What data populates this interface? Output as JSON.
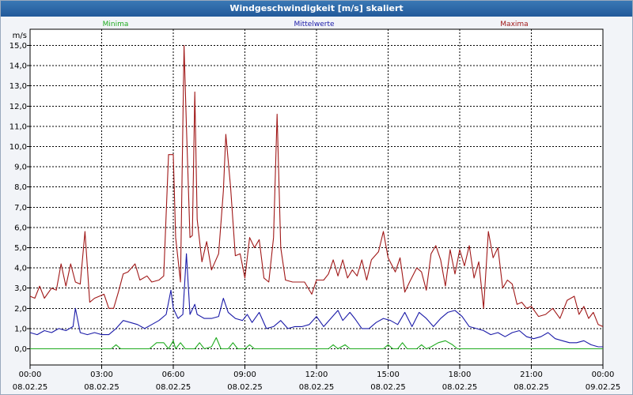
{
  "window": {
    "title": "Windgeschwindigkeit [m/s] skaliert"
  },
  "chart_data": {
    "type": "line",
    "title": "Windgeschwindigkeit [m/s] skaliert",
    "ylabel": "m/s",
    "ylim": [
      -0.8,
      15.8
    ],
    "xlim": [
      0,
      24
    ],
    "grid": true,
    "legend_position": "top",
    "yticks": [
      0,
      1,
      2,
      3,
      4,
      5,
      6,
      7,
      8,
      9,
      10,
      11,
      12,
      13,
      14,
      15
    ],
    "ytick_labels": [
      "0,0",
      "1,0",
      "2,0",
      "3,0",
      "4,0",
      "5,0",
      "6,0",
      "7,0",
      "8,0",
      "9,0",
      "10,0",
      "11,0",
      "12,0",
      "13,0",
      "14,0",
      "15,0"
    ],
    "xticks": [
      {
        "x": 0,
        "time": "00:00",
        "date": "08.02.25"
      },
      {
        "x": 3,
        "time": "03:00",
        "date": "08.02.25"
      },
      {
        "x": 6,
        "time": "06:00",
        "date": "08.02.25"
      },
      {
        "x": 9,
        "time": "09:00",
        "date": "08.02.25"
      },
      {
        "x": 12,
        "time": "12:00",
        "date": "08.02.25"
      },
      {
        "x": 15,
        "time": "15:00",
        "date": "08.02.25"
      },
      {
        "x": 18,
        "time": "18:00",
        "date": "08.02.25"
      },
      {
        "x": 21,
        "time": "21:00",
        "date": "08.02.25"
      },
      {
        "x": 24,
        "time": "00:00",
        "date": "09.02.25"
      }
    ],
    "series": [
      {
        "name": "Minima",
        "color": "#1faa1f",
        "points": [
          [
            0,
            0
          ],
          [
            3.4,
            0
          ],
          [
            3.6,
            0.2
          ],
          [
            3.8,
            0
          ],
          [
            5,
            0
          ],
          [
            5.3,
            0.3
          ],
          [
            5.6,
            0.3
          ],
          [
            5.8,
            0
          ],
          [
            6,
            0.4
          ],
          [
            6.1,
            0
          ],
          [
            6.3,
            0.3
          ],
          [
            6.5,
            0
          ],
          [
            6.9,
            0
          ],
          [
            7.1,
            0.3
          ],
          [
            7.3,
            0
          ],
          [
            7.6,
            0.1
          ],
          [
            7.8,
            0.55
          ],
          [
            8,
            0
          ],
          [
            8.3,
            0
          ],
          [
            8.5,
            0.3
          ],
          [
            8.7,
            0
          ],
          [
            9,
            0
          ],
          [
            9.2,
            0.2
          ],
          [
            9.4,
            0
          ],
          [
            12.5,
            0
          ],
          [
            12.7,
            0.2
          ],
          [
            12.9,
            0
          ],
          [
            13.2,
            0.2
          ],
          [
            13.4,
            0
          ],
          [
            14.8,
            0
          ],
          [
            15,
            0.2
          ],
          [
            15.2,
            0
          ],
          [
            15.4,
            0
          ],
          [
            15.6,
            0.3
          ],
          [
            15.8,
            0
          ],
          [
            16.2,
            0
          ],
          [
            16.4,
            0.2
          ],
          [
            16.6,
            0
          ],
          [
            16.8,
            0.1
          ],
          [
            17.1,
            0.3
          ],
          [
            17.4,
            0.4
          ],
          [
            17.7,
            0.2
          ],
          [
            17.9,
            0
          ],
          [
            24,
            0
          ]
        ]
      },
      {
        "name": "Mittelwerte",
        "color": "#1a1aa8",
        "points": [
          [
            0,
            0.8
          ],
          [
            0.3,
            0.7
          ],
          [
            0.6,
            0.9
          ],
          [
            0.9,
            0.8
          ],
          [
            1.2,
            1.0
          ],
          [
            1.5,
            0.9
          ],
          [
            1.8,
            1.1
          ],
          [
            1.9,
            2.0
          ],
          [
            2.1,
            0.8
          ],
          [
            2.4,
            0.7
          ],
          [
            2.7,
            0.8
          ],
          [
            3.0,
            0.7
          ],
          [
            3.3,
            0.7
          ],
          [
            3.6,
            1.0
          ],
          [
            3.9,
            1.4
          ],
          [
            4.2,
            1.3
          ],
          [
            4.5,
            1.2
          ],
          [
            4.8,
            1.0
          ],
          [
            5.1,
            1.2
          ],
          [
            5.4,
            1.4
          ],
          [
            5.7,
            1.7
          ],
          [
            5.9,
            2.9
          ],
          [
            6.0,
            2.0
          ],
          [
            6.2,
            1.5
          ],
          [
            6.4,
            1.7
          ],
          [
            6.55,
            4.7
          ],
          [
            6.7,
            1.7
          ],
          [
            6.9,
            2.2
          ],
          [
            7.0,
            1.7
          ],
          [
            7.3,
            1.5
          ],
          [
            7.6,
            1.5
          ],
          [
            7.9,
            1.6
          ],
          [
            8.1,
            2.5
          ],
          [
            8.3,
            1.8
          ],
          [
            8.6,
            1.5
          ],
          [
            8.9,
            1.4
          ],
          [
            9.1,
            1.7
          ],
          [
            9.3,
            1.3
          ],
          [
            9.6,
            1.8
          ],
          [
            9.9,
            1.0
          ],
          [
            10.2,
            1.1
          ],
          [
            10.5,
            1.4
          ],
          [
            10.8,
            1.0
          ],
          [
            11.1,
            1.1
          ],
          [
            11.4,
            1.1
          ],
          [
            11.7,
            1.2
          ],
          [
            12.0,
            1.6
          ],
          [
            12.3,
            1.1
          ],
          [
            12.6,
            1.5
          ],
          [
            12.9,
            1.9
          ],
          [
            13.1,
            1.4
          ],
          [
            13.4,
            1.8
          ],
          [
            13.6,
            1.5
          ],
          [
            13.9,
            1.0
          ],
          [
            14.2,
            1.0
          ],
          [
            14.5,
            1.3
          ],
          [
            14.8,
            1.5
          ],
          [
            15.1,
            1.4
          ],
          [
            15.4,
            1.2
          ],
          [
            15.7,
            1.8
          ],
          [
            16.0,
            1.1
          ],
          [
            16.3,
            1.8
          ],
          [
            16.6,
            1.5
          ],
          [
            16.9,
            1.1
          ],
          [
            17.2,
            1.5
          ],
          [
            17.5,
            1.8
          ],
          [
            17.8,
            1.9
          ],
          [
            18.1,
            1.6
          ],
          [
            18.4,
            1.1
          ],
          [
            18.7,
            1.0
          ],
          [
            19.0,
            0.9
          ],
          [
            19.3,
            0.7
          ],
          [
            19.6,
            0.8
          ],
          [
            19.9,
            0.6
          ],
          [
            20.2,
            0.8
          ],
          [
            20.5,
            0.9
          ],
          [
            20.8,
            0.6
          ],
          [
            21.1,
            0.5
          ],
          [
            21.4,
            0.6
          ],
          [
            21.7,
            0.8
          ],
          [
            22.0,
            0.5
          ],
          [
            22.3,
            0.4
          ],
          [
            22.6,
            0.3
          ],
          [
            22.9,
            0.3
          ],
          [
            23.2,
            0.4
          ],
          [
            23.5,
            0.2
          ],
          [
            23.8,
            0.1
          ],
          [
            24,
            0.1
          ]
        ]
      },
      {
        "name": "Maxima",
        "color": "#a01818",
        "points": [
          [
            0,
            2.6
          ],
          [
            0.2,
            2.5
          ],
          [
            0.4,
            3.1
          ],
          [
            0.6,
            2.5
          ],
          [
            0.9,
            3.0
          ],
          [
            1.1,
            2.9
          ],
          [
            1.3,
            4.2
          ],
          [
            1.5,
            3.1
          ],
          [
            1.7,
            4.2
          ],
          [
            1.9,
            3.3
          ],
          [
            2.1,
            3.2
          ],
          [
            2.3,
            5.8
          ],
          [
            2.5,
            2.3
          ],
          [
            2.7,
            2.5
          ],
          [
            2.9,
            2.6
          ],
          [
            3.1,
            2.7
          ],
          [
            3.3,
            2.0
          ],
          [
            3.5,
            2.0
          ],
          [
            3.7,
            2.8
          ],
          [
            3.9,
            3.7
          ],
          [
            4.1,
            3.8
          ],
          [
            4.4,
            4.2
          ],
          [
            4.6,
            3.4
          ],
          [
            4.9,
            3.6
          ],
          [
            5.1,
            3.3
          ],
          [
            5.4,
            3.4
          ],
          [
            5.6,
            3.6
          ],
          [
            5.8,
            9.6
          ],
          [
            6.0,
            9.6
          ],
          [
            6.1,
            5.5
          ],
          [
            6.3,
            3.3
          ],
          [
            6.45,
            15.0
          ],
          [
            6.55,
            11.0
          ],
          [
            6.7,
            5.5
          ],
          [
            6.8,
            5.6
          ],
          [
            6.9,
            12.7
          ],
          [
            7.0,
            6.4
          ],
          [
            7.2,
            4.3
          ],
          [
            7.4,
            5.3
          ],
          [
            7.6,
            3.9
          ],
          [
            7.9,
            4.7
          ],
          [
            8.1,
            7.8
          ],
          [
            8.2,
            10.6
          ],
          [
            8.4,
            8.0
          ],
          [
            8.6,
            4.6
          ],
          [
            8.8,
            4.7
          ],
          [
            9.0,
            3.5
          ],
          [
            9.2,
            5.5
          ],
          [
            9.4,
            5.0
          ],
          [
            9.6,
            5.4
          ],
          [
            9.8,
            3.5
          ],
          [
            10.0,
            3.3
          ],
          [
            10.2,
            5.5
          ],
          [
            10.35,
            11.6
          ],
          [
            10.5,
            5.0
          ],
          [
            10.7,
            3.4
          ],
          [
            11.0,
            3.3
          ],
          [
            11.3,
            3.3
          ],
          [
            11.5,
            3.3
          ],
          [
            11.8,
            2.7
          ],
          [
            12.0,
            3.4
          ],
          [
            12.3,
            3.4
          ],
          [
            12.5,
            3.7
          ],
          [
            12.7,
            4.4
          ],
          [
            12.9,
            3.6
          ],
          [
            13.1,
            4.4
          ],
          [
            13.3,
            3.5
          ],
          [
            13.5,
            3.9
          ],
          [
            13.7,
            3.6
          ],
          [
            13.9,
            4.4
          ],
          [
            14.1,
            3.4
          ],
          [
            14.3,
            4.4
          ],
          [
            14.6,
            4.8
          ],
          [
            14.8,
            5.8
          ],
          [
            15.0,
            4.5
          ],
          [
            15.3,
            3.8
          ],
          [
            15.5,
            4.5
          ],
          [
            15.7,
            2.8
          ],
          [
            15.9,
            3.3
          ],
          [
            16.2,
            4.0
          ],
          [
            16.4,
            3.8
          ],
          [
            16.6,
            2.9
          ],
          [
            16.8,
            4.7
          ],
          [
            17.0,
            5.1
          ],
          [
            17.2,
            4.4
          ],
          [
            17.4,
            3.1
          ],
          [
            17.6,
            4.9
          ],
          [
            17.8,
            3.7
          ],
          [
            18.0,
            4.9
          ],
          [
            18.2,
            4.1
          ],
          [
            18.4,
            5.1
          ],
          [
            18.6,
            3.5
          ],
          [
            18.8,
            4.3
          ],
          [
            19.0,
            2.0
          ],
          [
            19.2,
            5.8
          ],
          [
            19.4,
            4.5
          ],
          [
            19.6,
            5.0
          ],
          [
            19.8,
            3.0
          ],
          [
            20.0,
            3.4
          ],
          [
            20.2,
            3.2
          ],
          [
            20.4,
            2.2
          ],
          [
            20.6,
            2.3
          ],
          [
            20.8,
            2.0
          ],
          [
            21.0,
            2.1
          ],
          [
            21.3,
            1.6
          ],
          [
            21.6,
            1.7
          ],
          [
            21.9,
            2.0
          ],
          [
            22.2,
            1.5
          ],
          [
            22.5,
            2.4
          ],
          [
            22.8,
            2.6
          ],
          [
            23.0,
            1.7
          ],
          [
            23.2,
            2.1
          ],
          [
            23.4,
            1.5
          ],
          [
            23.6,
            1.8
          ],
          [
            23.8,
            1.2
          ],
          [
            24,
            1.1
          ]
        ]
      }
    ]
  }
}
